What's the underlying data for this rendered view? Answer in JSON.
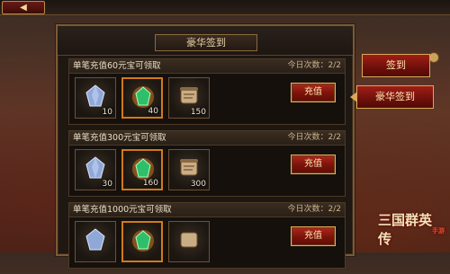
{
  "panel": {
    "title": "豪华签到",
    "cards": [
      {
        "title": "单笔充值60元宝可领取",
        "count": "今日次数：2/2",
        "button": "充值",
        "items": [
          {
            "icon": "crystal-icon",
            "qty": "10"
          },
          {
            "icon": "gem-icon",
            "qty": "40"
          },
          {
            "icon": "scroll-icon",
            "qty": "150"
          }
        ]
      },
      {
        "title": "单笔充值300元宝可领取",
        "count": "今日次数：2/2",
        "button": "充值",
        "items": [
          {
            "icon": "crystal-icon",
            "qty": "30"
          },
          {
            "icon": "gem-icon",
            "qty": "160"
          },
          {
            "icon": "scroll-icon",
            "qty": "300"
          }
        ]
      },
      {
        "title": "单笔充值1000元宝可领取",
        "count": "今日次数：2/2",
        "button": "充值",
        "items": [
          {
            "icon": "crystal-icon",
            "qty": ""
          },
          {
            "icon": "gem-icon",
            "qty": ""
          },
          {
            "icon": "scroll-icon",
            "qty": ""
          }
        ]
      }
    ]
  },
  "tabs": [
    {
      "label": "签到"
    },
    {
      "label": "豪华签到"
    }
  ],
  "logo": {
    "text": "三国群英传",
    "sub": "手游"
  },
  "colors": {
    "accent": "#d8a95a",
    "button": "#a01e16",
    "gold_border": "#d07a1a"
  }
}
